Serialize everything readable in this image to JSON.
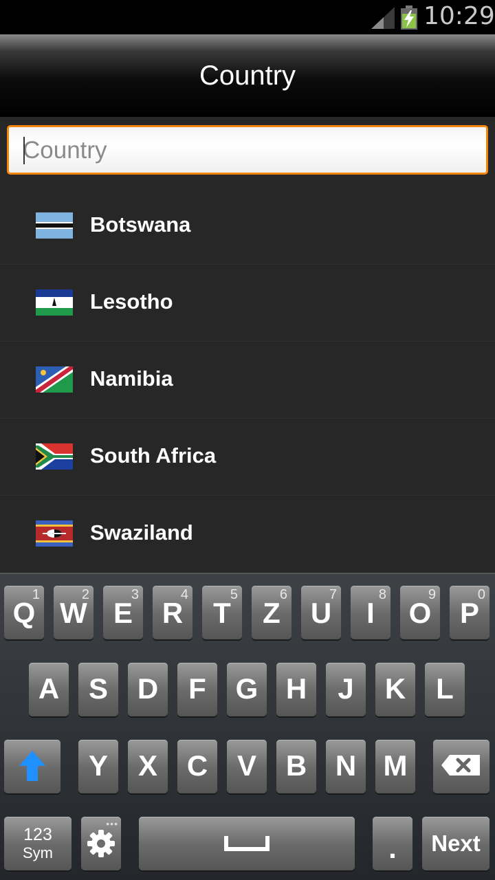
{
  "status_bar": {
    "time": "10:29",
    "signal_icon": "signal-icon",
    "battery_icon": "battery-charging-icon"
  },
  "action_bar": {
    "title": "Country"
  },
  "search": {
    "placeholder": "Country",
    "value": ""
  },
  "countries": [
    {
      "name": "Botswana",
      "flag_icon": "botswana-flag-icon"
    },
    {
      "name": "Lesotho",
      "flag_icon": "lesotho-flag-icon"
    },
    {
      "name": "Namibia",
      "flag_icon": "namibia-flag-icon"
    },
    {
      "name": "South Africa",
      "flag_icon": "south-africa-flag-icon"
    },
    {
      "name": "Swaziland",
      "flag_icon": "swaziland-flag-icon"
    }
  ],
  "keyboard": {
    "row1": [
      {
        "label": "Q",
        "sub": "1"
      },
      {
        "label": "W",
        "sub": "2"
      },
      {
        "label": "E",
        "sub": "3"
      },
      {
        "label": "R",
        "sub": "4"
      },
      {
        "label": "T",
        "sub": "5"
      },
      {
        "label": "Z",
        "sub": "6"
      },
      {
        "label": "U",
        "sub": "7"
      },
      {
        "label": "I",
        "sub": "8"
      },
      {
        "label": "O",
        "sub": "9"
      },
      {
        "label": "P",
        "sub": "0"
      }
    ],
    "row2": [
      "A",
      "S",
      "D",
      "F",
      "G",
      "H",
      "J",
      "K",
      "L"
    ],
    "row3": [
      "Y",
      "X",
      "C",
      "V",
      "B",
      "N",
      "M"
    ],
    "sym_top": "123",
    "sym_bottom": "Sym",
    "period": ".",
    "next": "Next",
    "settings_dots": "•••"
  },
  "colors": {
    "accent": "#f0850f",
    "list_bg": "#272727",
    "shift": "#1e90ff"
  }
}
